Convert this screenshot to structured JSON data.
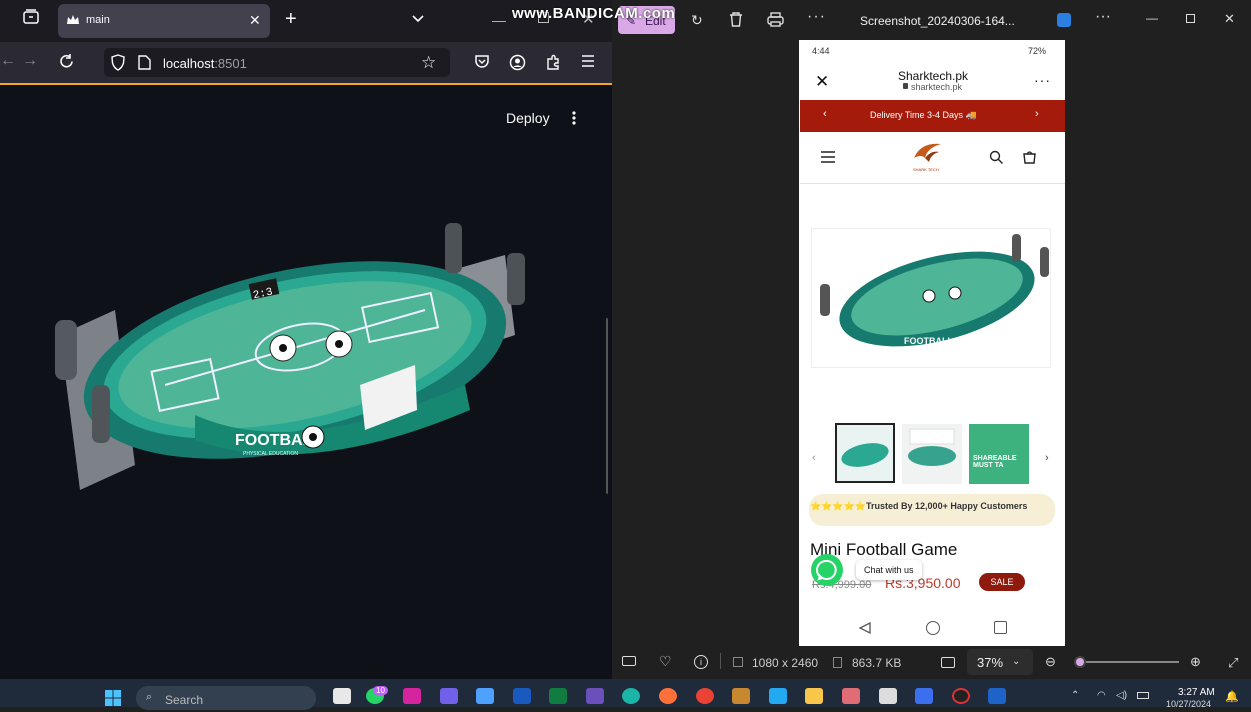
{
  "watermark": "www.BANDICAM.com",
  "firefox": {
    "tab_title": "main",
    "new_tab": "+",
    "url_host": "localhost",
    "url_port": ":8501",
    "app": {
      "deploy_label": "Deploy",
      "image_alt_text": "FOOTBALL",
      "image_sub_text": "PHYSICAL EDUCATION",
      "scoreboard": "2:3"
    }
  },
  "photos": {
    "edit_label": "Edit",
    "filename": "Screenshot_20240306-164...",
    "dimensions": "1080 x 2460",
    "filesize": "863.7 KB",
    "zoom": "37%",
    "zoom_level": 0.05
  },
  "phone": {
    "status_time": "4:44",
    "battery": "72%",
    "site_title": "Sharktech.pk",
    "site_url": "sharktech.pk",
    "banner_text": "Delivery Time 3-4 Days 🚚",
    "logo_text": "SHARK TECH",
    "trust_text": "⭐⭐⭐⭐⭐Trusted By 12,000+ Happy Customers",
    "product_title": "Mini Football Game",
    "old_price": "Rs.4,999.00",
    "new_price": "Rs.3,950.00",
    "sale_badge": "SALE",
    "chat_label": "Chat with us",
    "product_box_label": "FOOTBALL",
    "thumb_text": "SHAREABLE MUST TA"
  },
  "taskbar": {
    "search_placeholder": "Search",
    "notification_count": "10",
    "time": "3:27 AM",
    "date": "10/27/2024"
  },
  "colors": {
    "firefox_bg": "#1c1b22",
    "streamlit_bg": "#0e1117",
    "accent_orange": "#f5a623",
    "banner_red": "#a51b0b",
    "sale_red": "#8e1a0e",
    "price_red": "#c0392b",
    "table_teal": "#1f9d8a"
  }
}
